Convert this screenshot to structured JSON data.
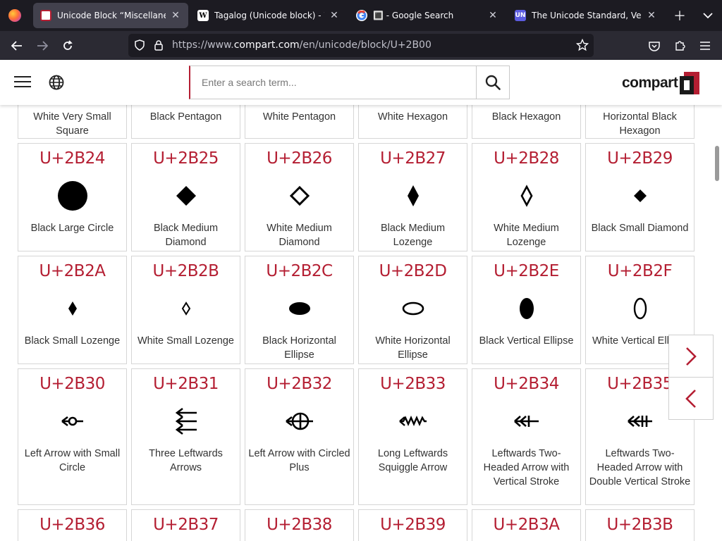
{
  "browser": {
    "tabs": [
      {
        "title": "Unicode Block “Miscellaneous S",
        "favicon": "compart-favicon",
        "active": true
      },
      {
        "title": "Tagalog (Unicode block) - Wikip",
        "favicon": "wikipedia-favicon",
        "active": false
      },
      {
        "title": "🔳 - Google Search",
        "favicon": "google-favicon",
        "active": false
      },
      {
        "title": "The Unicode Standard, Version",
        "favicon": "unicode-favicon",
        "active": false
      }
    ],
    "new_tab_icon": "plus-icon",
    "url_prefix": "https://www.",
    "url_domain": "compart.com",
    "url_path": "/en/unicode/block/U+2B00"
  },
  "site": {
    "search_placeholder": "Enter a search term...",
    "logo_text": "compart",
    "accent_color": "#b41e32"
  },
  "cards": [
    {
      "code": "",
      "name": "White Very Small Square",
      "glyph": "white-very-small-square"
    },
    {
      "code": "",
      "name": "Black Pentagon",
      "glyph": "black-pentagon"
    },
    {
      "code": "",
      "name": "White Pentagon",
      "glyph": "white-pentagon"
    },
    {
      "code": "",
      "name": "White Hexagon",
      "glyph": "white-hexagon"
    },
    {
      "code": "",
      "name": "Black Hexagon",
      "glyph": "black-hexagon"
    },
    {
      "code": "",
      "name": "Horizontal Black Hexagon",
      "glyph": "horizontal-black-hexagon"
    },
    {
      "code": "U+2B24",
      "name": "Black Large Circle",
      "glyph": "black-large-circle"
    },
    {
      "code": "U+2B25",
      "name": "Black Medium Diamond",
      "glyph": "black-medium-diamond"
    },
    {
      "code": "U+2B26",
      "name": "White Medium Diamond",
      "glyph": "white-medium-diamond"
    },
    {
      "code": "U+2B27",
      "name": "Black Medium Lozenge",
      "glyph": "black-medium-lozenge"
    },
    {
      "code": "U+2B28",
      "name": "White Medium Lozenge",
      "glyph": "white-medium-lozenge"
    },
    {
      "code": "U+2B29",
      "name": "Black Small Diamond",
      "glyph": "black-small-diamond"
    },
    {
      "code": "U+2B2A",
      "name": "Black Small Lozenge",
      "glyph": "black-small-lozenge"
    },
    {
      "code": "U+2B2B",
      "name": "White Small Lozenge",
      "glyph": "white-small-lozenge"
    },
    {
      "code": "U+2B2C",
      "name": "Black Horizontal Ellipse",
      "glyph": "black-horizontal-ellipse"
    },
    {
      "code": "U+2B2D",
      "name": "White Horizontal Ellipse",
      "glyph": "white-horizontal-ellipse"
    },
    {
      "code": "U+2B2E",
      "name": "Black Vertical Ellipse",
      "glyph": "black-vertical-ellipse"
    },
    {
      "code": "U+2B2F",
      "name": "White Vertical Elli",
      "glyph": "white-vertical-ellipse"
    },
    {
      "code": "U+2B30",
      "name": "Left Arrow with Small Circle",
      "glyph": "left-arrow-small-circle"
    },
    {
      "code": "U+2B31",
      "name": "Three Leftwards Arrows",
      "glyph": "three-leftwards-arrows"
    },
    {
      "code": "U+2B32",
      "name": "Left Arrow with Circled Plus",
      "glyph": "left-arrow-circled-plus"
    },
    {
      "code": "U+2B33",
      "name": "Long Leftwards Squiggle Arrow",
      "glyph": "long-leftwards-squiggle-arrow"
    },
    {
      "code": "U+2B34",
      "name": "Leftwards Two-Headed Arrow with Vertical Stroke",
      "glyph": "two-headed-arrow-vertical-stroke"
    },
    {
      "code": "U+2B35",
      "name": "Leftwards Two-Headed Arrow with Double Vertical Stroke",
      "glyph": "two-headed-arrow-double-vertical-stroke"
    },
    {
      "code": "U+2B36",
      "name": "",
      "glyph": ""
    },
    {
      "code": "U+2B37",
      "name": "",
      "glyph": ""
    },
    {
      "code": "U+2B38",
      "name": "",
      "glyph": ""
    },
    {
      "code": "U+2B39",
      "name": "",
      "glyph": ""
    },
    {
      "code": "U+2B3A",
      "name": "",
      "glyph": ""
    },
    {
      "code": "U+2B3B",
      "name": "",
      "glyph": ""
    }
  ],
  "nav_arrows": {
    "next": "chevron-right-icon",
    "prev": "chevron-left-icon"
  }
}
